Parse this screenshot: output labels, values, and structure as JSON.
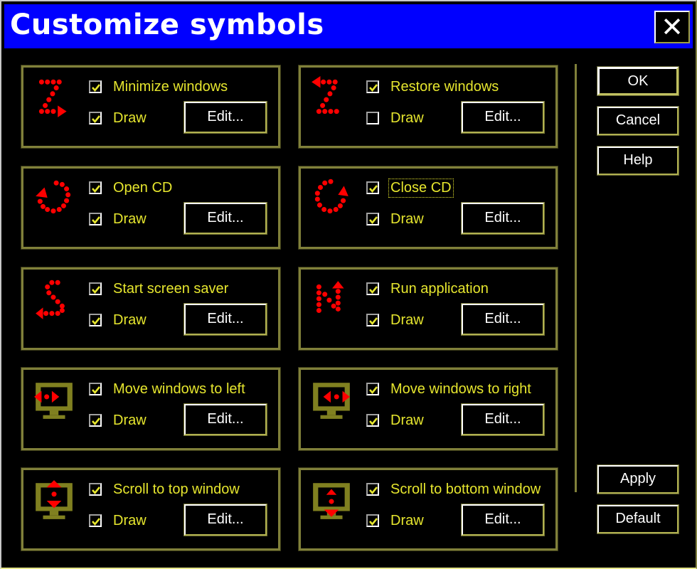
{
  "window": {
    "title": "Customize symbols",
    "close_label": "✕",
    "close_icon": "close-icon"
  },
  "colors": {
    "titlebar": "#0000ff",
    "background": "#000000",
    "label_text": "#e6e62e",
    "group_border": "#80803a",
    "symbol_red": "#ff0000",
    "monitor_olive": "#808020"
  },
  "groups": [
    {
      "label": "Minimize windows",
      "enabled": true,
      "draw_label": "Draw",
      "draw": true,
      "edit_label": "Edit...",
      "icon": "z-arrow-right-icon",
      "focused": false
    },
    {
      "label": "Restore windows",
      "enabled": true,
      "draw_label": "Draw",
      "draw": false,
      "edit_label": "Edit...",
      "icon": "z-arrow-left-icon",
      "focused": false
    },
    {
      "label": "Open CD",
      "enabled": true,
      "draw_label": "Draw",
      "draw": true,
      "edit_label": "Edit...",
      "icon": "circle-arrow-ccw-icon",
      "focused": false
    },
    {
      "label": "Close CD",
      "enabled": true,
      "draw_label": "Draw",
      "draw": true,
      "edit_label": "Edit...",
      "icon": "circle-arrow-cw-icon",
      "focused": true
    },
    {
      "label": "Start screen saver",
      "enabled": true,
      "draw_label": "Draw",
      "draw": true,
      "edit_label": "Edit...",
      "icon": "s-arrow-icon",
      "focused": false
    },
    {
      "label": "Run application",
      "enabled": true,
      "draw_label": "Draw",
      "draw": true,
      "edit_label": "Edit...",
      "icon": "n-arrow-icon",
      "focused": false
    },
    {
      "label": "Move windows to left",
      "enabled": true,
      "draw_label": "Draw",
      "draw": true,
      "edit_label": "Edit...",
      "icon": "monitor-arrows-left-icon",
      "focused": false
    },
    {
      "label": "Move windows to right",
      "enabled": true,
      "draw_label": "Draw",
      "draw": true,
      "edit_label": "Edit...",
      "icon": "monitor-arrows-right-icon",
      "focused": false
    },
    {
      "label": "Scroll to top window",
      "enabled": true,
      "draw_label": "Draw",
      "draw": true,
      "edit_label": "Edit...",
      "icon": "monitor-arrow-up-icon",
      "focused": false
    },
    {
      "label": "Scroll to bottom window",
      "enabled": true,
      "draw_label": "Draw",
      "draw": true,
      "edit_label": "Edit...",
      "icon": "monitor-arrow-down-icon",
      "focused": false
    }
  ],
  "buttons": {
    "ok": "OK",
    "cancel": "Cancel",
    "help": "Help",
    "apply": "Apply",
    "default": "Default"
  }
}
